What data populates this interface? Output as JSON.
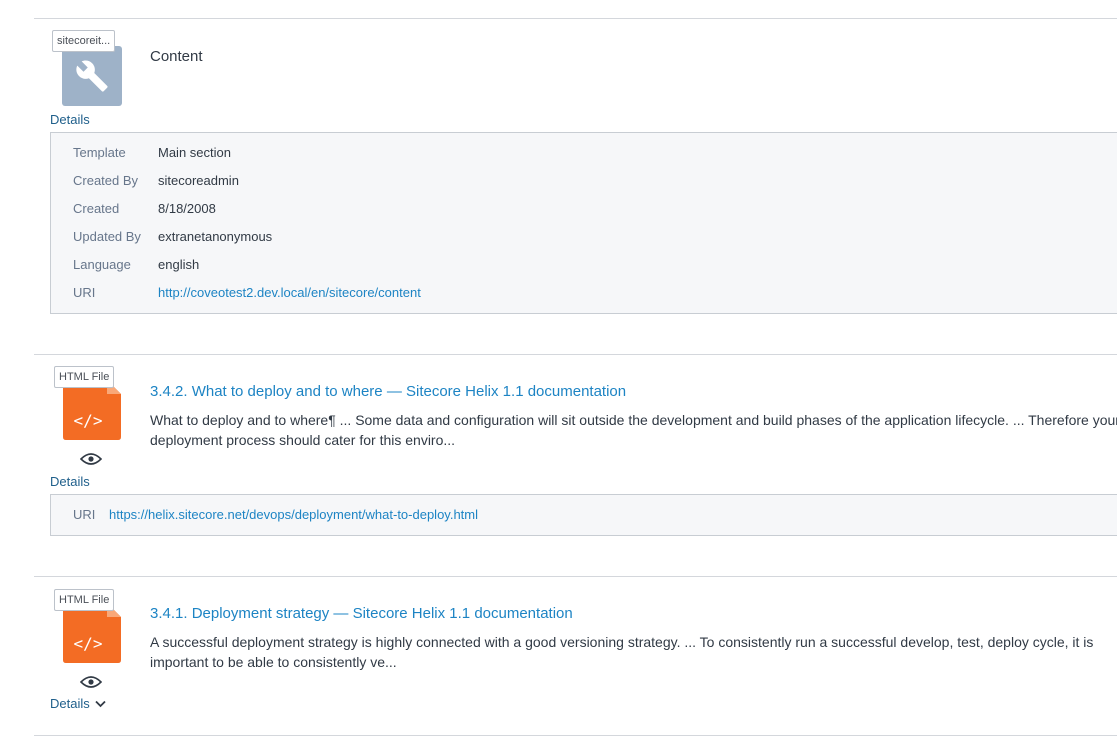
{
  "results": [
    {
      "type_tag": "sitecoreit...",
      "icon": "wrench-icon",
      "title": "Content",
      "details_label": "Details",
      "fields": [
        {
          "key": "Template",
          "value": "Main section"
        },
        {
          "key": "Created By",
          "value": "sitecoreadmin"
        },
        {
          "key": "Created",
          "value": "8/18/2008"
        },
        {
          "key": "Updated By",
          "value": "extranetanonymous"
        },
        {
          "key": "Language",
          "value": "english"
        },
        {
          "key": "URI",
          "value": "http://coveotest2.dev.local/en/sitecore/content"
        }
      ]
    },
    {
      "type_tag": "HTML File",
      "icon": "html-file-icon",
      "file_glyph": "</>",
      "title": "3.4.2. What to deploy and to where — Sitecore Helix 1.1 documentation",
      "excerpt": "What to deploy and to where¶ ... Some data and configuration will sit outside the development and build phases of the application lifecycle. ... Therefore your deployment process should cater for this enviro...",
      "details_label": "Details",
      "fields": [
        {
          "key": "URI",
          "value": "https://helix.sitecore.net/devops/deployment/what-to-deploy.html"
        }
      ]
    },
    {
      "type_tag": "HTML File",
      "icon": "html-file-icon",
      "file_glyph": "</>",
      "title": "3.4.1. Deployment strategy — Sitecore Helix 1.1 documentation",
      "excerpt": "A successful deployment strategy is highly connected with a good versioning strategy. ... To consistently run a successful develop, test, deploy cycle, it is important to be able to consistently ve...",
      "details_label": "Details"
    }
  ],
  "colors": {
    "link": "#1d84c4",
    "details_link": "#1f5f8b",
    "file_icon": "#f36c24",
    "item_icon": "#9eb2c8",
    "panel_bg": "#f6f7f9"
  }
}
